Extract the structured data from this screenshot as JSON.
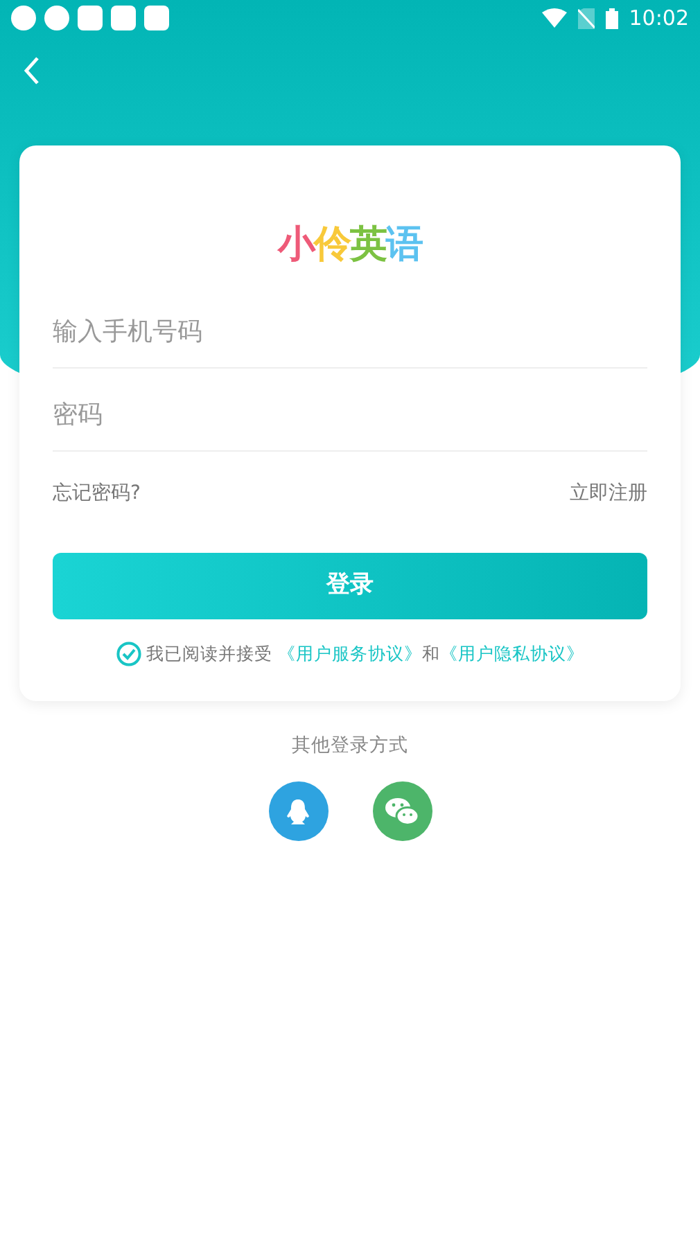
{
  "status_bar": {
    "time": "10:02"
  },
  "logo": [
    {
      "text": "小",
      "color": "#ee5a78"
    },
    {
      "text": "伶",
      "color": "#f8c93a"
    },
    {
      "text": "英",
      "color": "#7cc242"
    },
    {
      "text": "语",
      "color": "#5cc2f0"
    }
  ],
  "fields": [
    {
      "placeholder": "输入手机号码"
    },
    {
      "placeholder": "密码"
    }
  ],
  "forgot_link": "忘记密码?",
  "register_link": "立即注册",
  "login_button": "登录",
  "agreement": {
    "checked": true,
    "prefix": "我已阅读并接受",
    "terms_link": "《用户服务协议》",
    "middle": "和",
    "privacy_link": "《用户隐私协议》"
  },
  "other_login": {
    "title": "其他登录方式",
    "options": [
      {
        "kind": "qq"
      },
      {
        "kind": "wechat"
      }
    ]
  }
}
